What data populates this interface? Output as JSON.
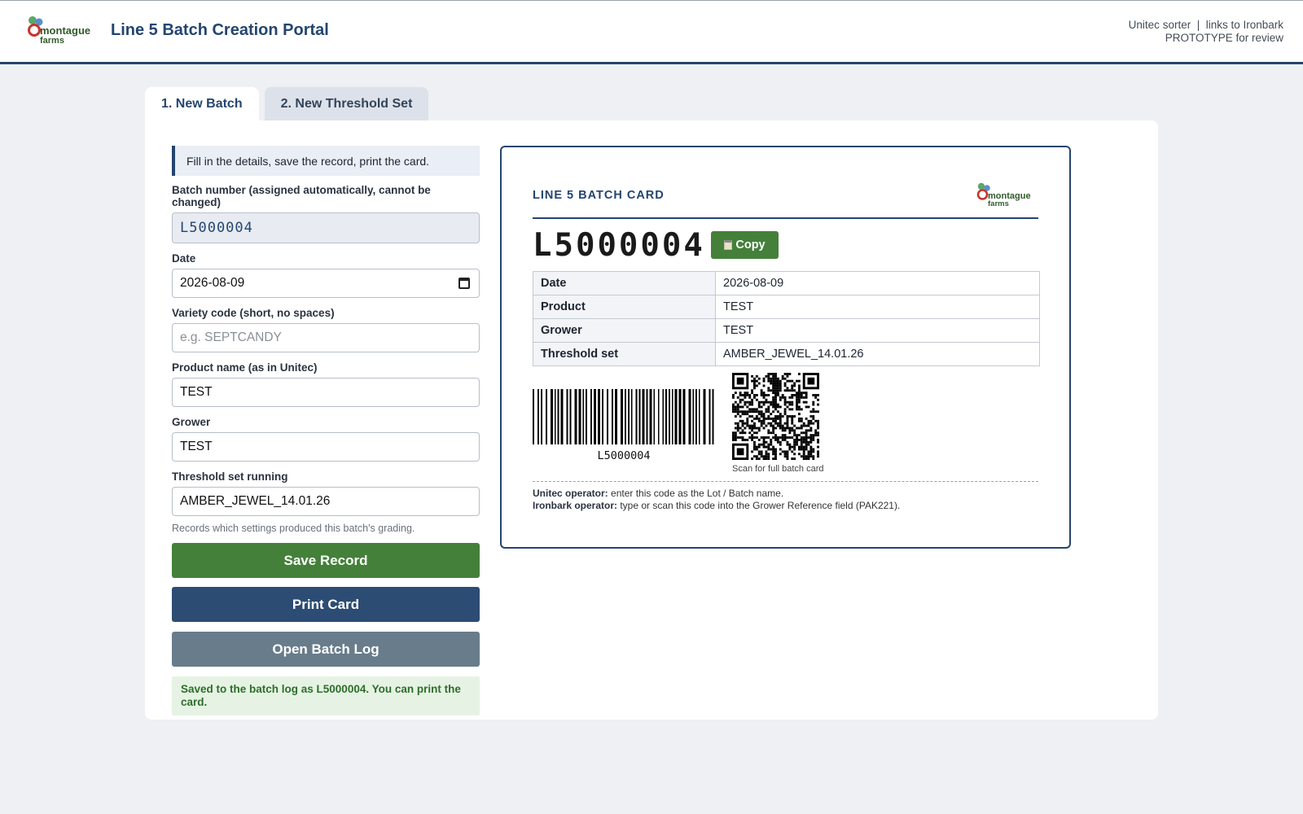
{
  "header": {
    "title": "Line 5 Batch Creation Portal",
    "logo_text_line1": "montague",
    "logo_text_line2": "farms",
    "right_line1": "Unitec sorter  |  links to Ironbark",
    "right_line2": "PROTOTYPE for review"
  },
  "tabs": [
    {
      "label": "1. New Batch",
      "active": true
    },
    {
      "label": "2. New Threshold Set",
      "active": false
    }
  ],
  "form": {
    "info": "Fill in the details, save the record, print the card.",
    "batch_number_label": "Batch number (assigned automatically, cannot be changed)",
    "batch_number_value": "L5000004",
    "date_label": "Date",
    "date_value": "2026-08-09",
    "variety_label": "Variety code (short, no spaces)",
    "variety_placeholder": "e.g. SEPTCANDY",
    "product_label": "Product name (as in Unitec)",
    "product_value": "TEST",
    "grower_label": "Grower",
    "grower_value": "TEST",
    "threshold_label": "Threshold set running",
    "threshold_value": "AMBER_JEWEL_14.01.26",
    "threshold_hint": "Records which settings produced this batch's grading.",
    "save_label": "Save Record",
    "print_label": "Print Card",
    "log_label": "Open Batch Log",
    "success_message": "Saved to the batch log as L5000004. You can print the card."
  },
  "card": {
    "title": "LINE 5 BATCH CARD",
    "code": "L5000004",
    "copy_label": "Copy",
    "rows": [
      {
        "key": "Date",
        "value": "2026-08-09"
      },
      {
        "key": "Product",
        "value": "TEST"
      },
      {
        "key": "Grower",
        "value": "TEST"
      },
      {
        "key": "Threshold set",
        "value": "AMBER_JEWEL_14.01.26"
      }
    ],
    "barcode_text": "L5000004",
    "qr_caption": "Scan for full batch card",
    "note1_label": "Unitec operator:",
    "note1_text": " enter this code as the Lot / Batch name.",
    "note2_label": "Ironbark operator:",
    "note2_text": " type or scan this code into the Grower Reference field (PAK221)."
  },
  "colors": {
    "navy": "#24456f",
    "green": "#44803a",
    "slate": "#687c8b",
    "success_bg": "#e6f3e4"
  }
}
